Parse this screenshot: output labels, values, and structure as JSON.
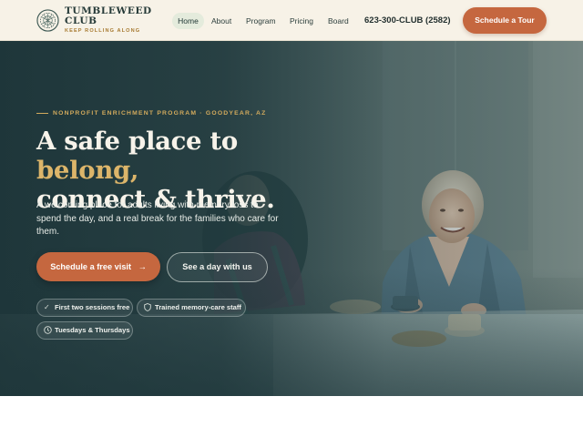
{
  "header": {
    "brand_name": "TUMBLEWEED CLUB",
    "brand_tagline": "KEEP ROLLING ALONG",
    "logo_icon": "tumbleweed-logo-icon",
    "nav": [
      {
        "label": "Home",
        "active": true
      },
      {
        "label": "About"
      },
      {
        "label": "Program"
      },
      {
        "label": "Pricing"
      },
      {
        "label": "Board"
      }
    ],
    "phone": "623-300-CLUB (2582)",
    "tour_button": "Schedule a Tour"
  },
  "hero": {
    "eyebrow": "NONPROFIT ENRICHMENT PROGRAM · GOODYEAR, AZ",
    "headline_part1": "A safe place to ",
    "headline_accent": "belong,",
    "headline_part2": "connect & thrive.",
    "lead": "A welcoming place for adults living with memory loss to spend the day, and a real break for the families who care for them.",
    "primary_cta": "Schedule a free visit",
    "primary_cta_icon": "arrow-right-icon",
    "secondary_cta": "See a day with us",
    "chips": [
      {
        "label": "First two sessions free",
        "icon": "check-icon"
      },
      {
        "label": "Trained memory-care staff",
        "icon": "shield-icon"
      },
      {
        "label": "Tuesdays & Thursdays",
        "icon": "clock-icon"
      }
    ]
  },
  "colors": {
    "header_bg": "#f7f2e7",
    "accent_orange": "#c5673f",
    "accent_gold": "#dcb56a",
    "hero_teal": "#2d4648"
  }
}
